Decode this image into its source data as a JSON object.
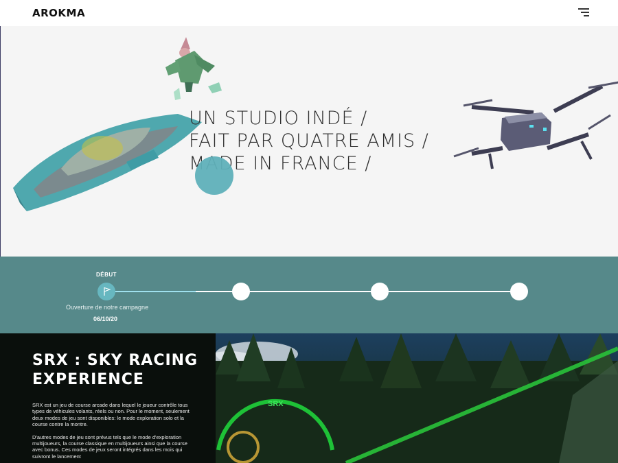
{
  "header": {
    "brand": "AROKMA",
    "menu_icon": "hamburger-menu-icon"
  },
  "hero": {
    "tagline_lines": [
      "UN STUDIO INDÉ /",
      "FAIT PAR QUATRE AMIS /",
      "MADE IN FRANCE /"
    ],
    "accent_color": "#5fb0b9"
  },
  "timeline": {
    "start_label": "DÉBUT",
    "milestone_description": "Ouverture de notre campagne",
    "milestone_date": "06/10/20",
    "node_count": 4,
    "band_color": "#56898a"
  },
  "game": {
    "title_line1": "SRX : SKY RACING",
    "title_line2": "EXPERIENCE",
    "paragraph1": "SRX est un jeu de course arcade dans lequel le joueur contrôle tous types de véhicules volants, réels ou non. Pour le moment, seulement deux modes de jeu sont disponibles: le mode exploration solo et la course contre la montre.",
    "paragraph2": "D'autres modes de jeu sont prévus tels que le mode d'exploration multijoueurs, la course classique en multijoueurs ainsi que la course avec bonus. Ces modes de jeux seront intégrés dans les mois qui suivront le lancement",
    "hud_logo": "SRX"
  }
}
